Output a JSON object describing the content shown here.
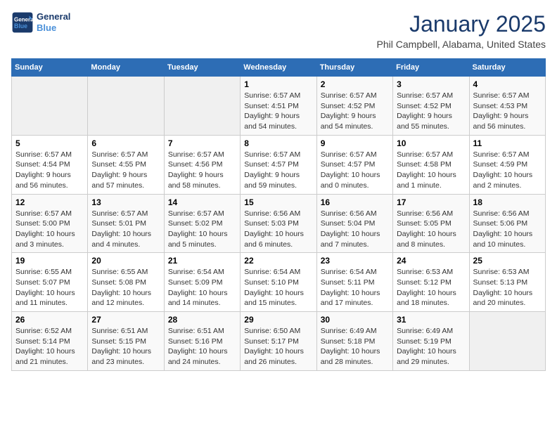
{
  "header": {
    "logo_line1": "General",
    "logo_line2": "Blue",
    "month_year": "January 2025",
    "location": "Phil Campbell, Alabama, United States"
  },
  "weekdays": [
    "Sunday",
    "Monday",
    "Tuesday",
    "Wednesday",
    "Thursday",
    "Friday",
    "Saturday"
  ],
  "weeks": [
    [
      {
        "day": "",
        "info": ""
      },
      {
        "day": "",
        "info": ""
      },
      {
        "day": "",
        "info": ""
      },
      {
        "day": "1",
        "info": "Sunrise: 6:57 AM\nSunset: 4:51 PM\nDaylight: 9 hours\nand 54 minutes."
      },
      {
        "day": "2",
        "info": "Sunrise: 6:57 AM\nSunset: 4:52 PM\nDaylight: 9 hours\nand 54 minutes."
      },
      {
        "day": "3",
        "info": "Sunrise: 6:57 AM\nSunset: 4:52 PM\nDaylight: 9 hours\nand 55 minutes."
      },
      {
        "day": "4",
        "info": "Sunrise: 6:57 AM\nSunset: 4:53 PM\nDaylight: 9 hours\nand 56 minutes."
      }
    ],
    [
      {
        "day": "5",
        "info": "Sunrise: 6:57 AM\nSunset: 4:54 PM\nDaylight: 9 hours\nand 56 minutes."
      },
      {
        "day": "6",
        "info": "Sunrise: 6:57 AM\nSunset: 4:55 PM\nDaylight: 9 hours\nand 57 minutes."
      },
      {
        "day": "7",
        "info": "Sunrise: 6:57 AM\nSunset: 4:56 PM\nDaylight: 9 hours\nand 58 minutes."
      },
      {
        "day": "8",
        "info": "Sunrise: 6:57 AM\nSunset: 4:57 PM\nDaylight: 9 hours\nand 59 minutes."
      },
      {
        "day": "9",
        "info": "Sunrise: 6:57 AM\nSunset: 4:57 PM\nDaylight: 10 hours\nand 0 minutes."
      },
      {
        "day": "10",
        "info": "Sunrise: 6:57 AM\nSunset: 4:58 PM\nDaylight: 10 hours\nand 1 minute."
      },
      {
        "day": "11",
        "info": "Sunrise: 6:57 AM\nSunset: 4:59 PM\nDaylight: 10 hours\nand 2 minutes."
      }
    ],
    [
      {
        "day": "12",
        "info": "Sunrise: 6:57 AM\nSunset: 5:00 PM\nDaylight: 10 hours\nand 3 minutes."
      },
      {
        "day": "13",
        "info": "Sunrise: 6:57 AM\nSunset: 5:01 PM\nDaylight: 10 hours\nand 4 minutes."
      },
      {
        "day": "14",
        "info": "Sunrise: 6:57 AM\nSunset: 5:02 PM\nDaylight: 10 hours\nand 5 minutes."
      },
      {
        "day": "15",
        "info": "Sunrise: 6:56 AM\nSunset: 5:03 PM\nDaylight: 10 hours\nand 6 minutes."
      },
      {
        "day": "16",
        "info": "Sunrise: 6:56 AM\nSunset: 5:04 PM\nDaylight: 10 hours\nand 7 minutes."
      },
      {
        "day": "17",
        "info": "Sunrise: 6:56 AM\nSunset: 5:05 PM\nDaylight: 10 hours\nand 8 minutes."
      },
      {
        "day": "18",
        "info": "Sunrise: 6:56 AM\nSunset: 5:06 PM\nDaylight: 10 hours\nand 10 minutes."
      }
    ],
    [
      {
        "day": "19",
        "info": "Sunrise: 6:55 AM\nSunset: 5:07 PM\nDaylight: 10 hours\nand 11 minutes."
      },
      {
        "day": "20",
        "info": "Sunrise: 6:55 AM\nSunset: 5:08 PM\nDaylight: 10 hours\nand 12 minutes."
      },
      {
        "day": "21",
        "info": "Sunrise: 6:54 AM\nSunset: 5:09 PM\nDaylight: 10 hours\nand 14 minutes."
      },
      {
        "day": "22",
        "info": "Sunrise: 6:54 AM\nSunset: 5:10 PM\nDaylight: 10 hours\nand 15 minutes."
      },
      {
        "day": "23",
        "info": "Sunrise: 6:54 AM\nSunset: 5:11 PM\nDaylight: 10 hours\nand 17 minutes."
      },
      {
        "day": "24",
        "info": "Sunrise: 6:53 AM\nSunset: 5:12 PM\nDaylight: 10 hours\nand 18 minutes."
      },
      {
        "day": "25",
        "info": "Sunrise: 6:53 AM\nSunset: 5:13 PM\nDaylight: 10 hours\nand 20 minutes."
      }
    ],
    [
      {
        "day": "26",
        "info": "Sunrise: 6:52 AM\nSunset: 5:14 PM\nDaylight: 10 hours\nand 21 minutes."
      },
      {
        "day": "27",
        "info": "Sunrise: 6:51 AM\nSunset: 5:15 PM\nDaylight: 10 hours\nand 23 minutes."
      },
      {
        "day": "28",
        "info": "Sunrise: 6:51 AM\nSunset: 5:16 PM\nDaylight: 10 hours\nand 24 minutes."
      },
      {
        "day": "29",
        "info": "Sunrise: 6:50 AM\nSunset: 5:17 PM\nDaylight: 10 hours\nand 26 minutes."
      },
      {
        "day": "30",
        "info": "Sunrise: 6:49 AM\nSunset: 5:18 PM\nDaylight: 10 hours\nand 28 minutes."
      },
      {
        "day": "31",
        "info": "Sunrise: 6:49 AM\nSunset: 5:19 PM\nDaylight: 10 hours\nand 29 minutes."
      },
      {
        "day": "",
        "info": ""
      }
    ]
  ]
}
